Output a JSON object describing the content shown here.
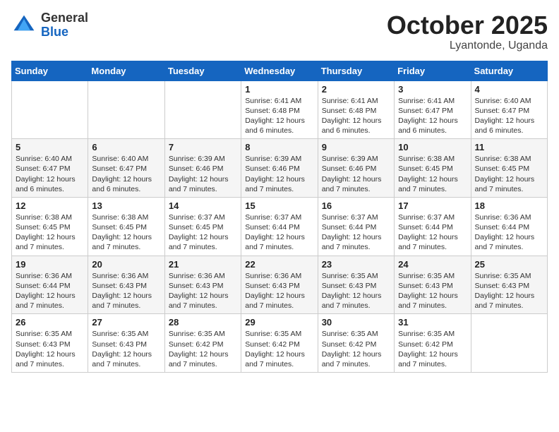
{
  "logo": {
    "general": "General",
    "blue": "Blue"
  },
  "title": {
    "month": "October 2025",
    "location": "Lyantonde, Uganda"
  },
  "headers": [
    "Sunday",
    "Monday",
    "Tuesday",
    "Wednesday",
    "Thursday",
    "Friday",
    "Saturday"
  ],
  "weeks": [
    [
      {
        "day": "",
        "info": ""
      },
      {
        "day": "",
        "info": ""
      },
      {
        "day": "",
        "info": ""
      },
      {
        "day": "1",
        "info": "Sunrise: 6:41 AM\nSunset: 6:48 PM\nDaylight: 12 hours\nand 6 minutes."
      },
      {
        "day": "2",
        "info": "Sunrise: 6:41 AM\nSunset: 6:48 PM\nDaylight: 12 hours\nand 6 minutes."
      },
      {
        "day": "3",
        "info": "Sunrise: 6:41 AM\nSunset: 6:47 PM\nDaylight: 12 hours\nand 6 minutes."
      },
      {
        "day": "4",
        "info": "Sunrise: 6:40 AM\nSunset: 6:47 PM\nDaylight: 12 hours\nand 6 minutes."
      }
    ],
    [
      {
        "day": "5",
        "info": "Sunrise: 6:40 AM\nSunset: 6:47 PM\nDaylight: 12 hours\nand 6 minutes."
      },
      {
        "day": "6",
        "info": "Sunrise: 6:40 AM\nSunset: 6:47 PM\nDaylight: 12 hours\nand 6 minutes."
      },
      {
        "day": "7",
        "info": "Sunrise: 6:39 AM\nSunset: 6:46 PM\nDaylight: 12 hours\nand 7 minutes."
      },
      {
        "day": "8",
        "info": "Sunrise: 6:39 AM\nSunset: 6:46 PM\nDaylight: 12 hours\nand 7 minutes."
      },
      {
        "day": "9",
        "info": "Sunrise: 6:39 AM\nSunset: 6:46 PM\nDaylight: 12 hours\nand 7 minutes."
      },
      {
        "day": "10",
        "info": "Sunrise: 6:38 AM\nSunset: 6:45 PM\nDaylight: 12 hours\nand 7 minutes."
      },
      {
        "day": "11",
        "info": "Sunrise: 6:38 AM\nSunset: 6:45 PM\nDaylight: 12 hours\nand 7 minutes."
      }
    ],
    [
      {
        "day": "12",
        "info": "Sunrise: 6:38 AM\nSunset: 6:45 PM\nDaylight: 12 hours\nand 7 minutes."
      },
      {
        "day": "13",
        "info": "Sunrise: 6:38 AM\nSunset: 6:45 PM\nDaylight: 12 hours\nand 7 minutes."
      },
      {
        "day": "14",
        "info": "Sunrise: 6:37 AM\nSunset: 6:45 PM\nDaylight: 12 hours\nand 7 minutes."
      },
      {
        "day": "15",
        "info": "Sunrise: 6:37 AM\nSunset: 6:44 PM\nDaylight: 12 hours\nand 7 minutes."
      },
      {
        "day": "16",
        "info": "Sunrise: 6:37 AM\nSunset: 6:44 PM\nDaylight: 12 hours\nand 7 minutes."
      },
      {
        "day": "17",
        "info": "Sunrise: 6:37 AM\nSunset: 6:44 PM\nDaylight: 12 hours\nand 7 minutes."
      },
      {
        "day": "18",
        "info": "Sunrise: 6:36 AM\nSunset: 6:44 PM\nDaylight: 12 hours\nand 7 minutes."
      }
    ],
    [
      {
        "day": "19",
        "info": "Sunrise: 6:36 AM\nSunset: 6:44 PM\nDaylight: 12 hours\nand 7 minutes."
      },
      {
        "day": "20",
        "info": "Sunrise: 6:36 AM\nSunset: 6:43 PM\nDaylight: 12 hours\nand 7 minutes."
      },
      {
        "day": "21",
        "info": "Sunrise: 6:36 AM\nSunset: 6:43 PM\nDaylight: 12 hours\nand 7 minutes."
      },
      {
        "day": "22",
        "info": "Sunrise: 6:36 AM\nSunset: 6:43 PM\nDaylight: 12 hours\nand 7 minutes."
      },
      {
        "day": "23",
        "info": "Sunrise: 6:35 AM\nSunset: 6:43 PM\nDaylight: 12 hours\nand 7 minutes."
      },
      {
        "day": "24",
        "info": "Sunrise: 6:35 AM\nSunset: 6:43 PM\nDaylight: 12 hours\nand 7 minutes."
      },
      {
        "day": "25",
        "info": "Sunrise: 6:35 AM\nSunset: 6:43 PM\nDaylight: 12 hours\nand 7 minutes."
      }
    ],
    [
      {
        "day": "26",
        "info": "Sunrise: 6:35 AM\nSunset: 6:43 PM\nDaylight: 12 hours\nand 7 minutes."
      },
      {
        "day": "27",
        "info": "Sunrise: 6:35 AM\nSunset: 6:43 PM\nDaylight: 12 hours\nand 7 minutes."
      },
      {
        "day": "28",
        "info": "Sunrise: 6:35 AM\nSunset: 6:42 PM\nDaylight: 12 hours\nand 7 minutes."
      },
      {
        "day": "29",
        "info": "Sunrise: 6:35 AM\nSunset: 6:42 PM\nDaylight: 12 hours\nand 7 minutes."
      },
      {
        "day": "30",
        "info": "Sunrise: 6:35 AM\nSunset: 6:42 PM\nDaylight: 12 hours\nand 7 minutes."
      },
      {
        "day": "31",
        "info": "Sunrise: 6:35 AM\nSunset: 6:42 PM\nDaylight: 12 hours\nand 7 minutes."
      },
      {
        "day": "",
        "info": ""
      }
    ]
  ]
}
